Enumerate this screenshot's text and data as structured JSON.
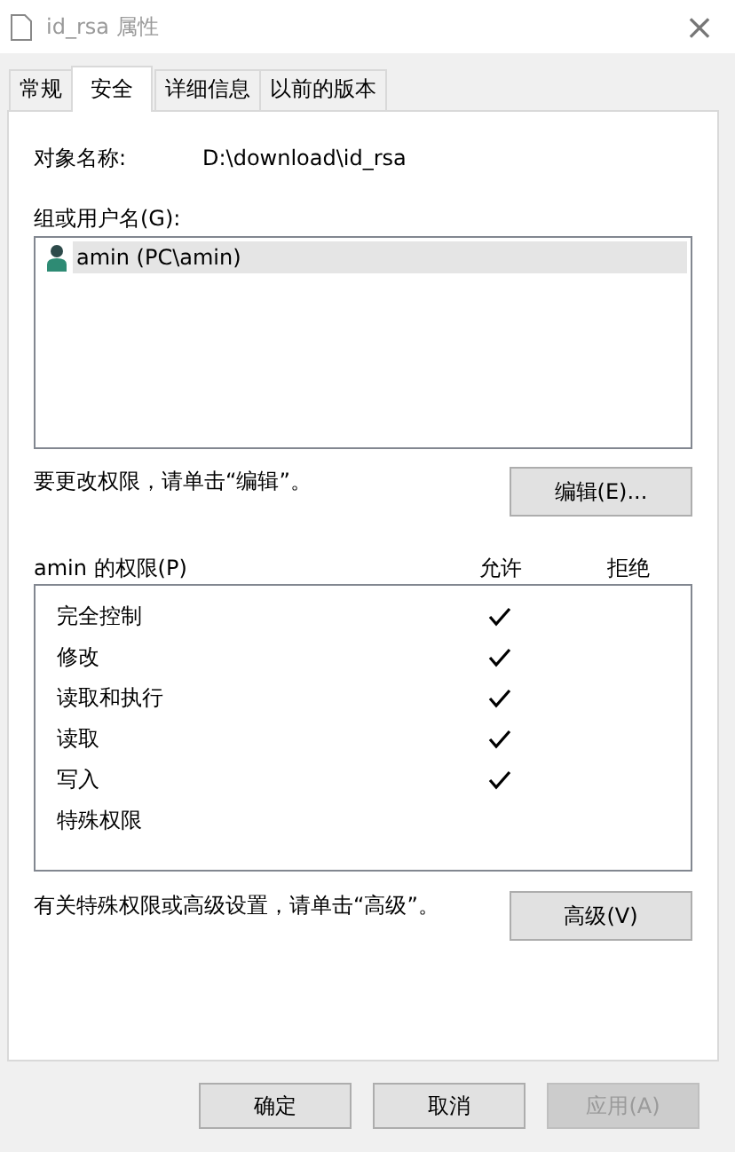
{
  "window": {
    "title": "id_rsa 属性",
    "close": "×"
  },
  "tabs": [
    {
      "label": "常规",
      "selected": false
    },
    {
      "label": "安全",
      "selected": true
    },
    {
      "label": "详细信息",
      "selected": false
    },
    {
      "label": "以前的版本",
      "selected": false
    }
  ],
  "object": {
    "label": "对象名称:",
    "value": "D:\\download\\id_rsa"
  },
  "users": {
    "label": "组或用户名(G):",
    "items": [
      {
        "name": "amin (PC\\amin)",
        "selected": true
      }
    ]
  },
  "edit_hint": "要更改权限，请单击“编辑”。",
  "edit_button": "编辑(E)...",
  "permissions": {
    "label": "amin 的权限(P)",
    "allow_header": "允许",
    "deny_header": "拒绝",
    "rows": [
      {
        "name": "完全控制",
        "allow": true,
        "deny": false
      },
      {
        "name": "修改",
        "allow": true,
        "deny": false
      },
      {
        "name": "读取和执行",
        "allow": true,
        "deny": false
      },
      {
        "name": "读取",
        "allow": true,
        "deny": false
      },
      {
        "name": "写入",
        "allow": true,
        "deny": false
      },
      {
        "name": "特殊权限",
        "allow": false,
        "deny": false
      }
    ]
  },
  "advanced_hint": "有关特殊权限或高级设置，请单击“高级”。",
  "advanced_button": "高级(V)",
  "buttons": [
    {
      "label": "确定",
      "disabled": false
    },
    {
      "label": "取消",
      "disabled": false
    },
    {
      "label": "应用(A)",
      "disabled": true
    }
  ]
}
